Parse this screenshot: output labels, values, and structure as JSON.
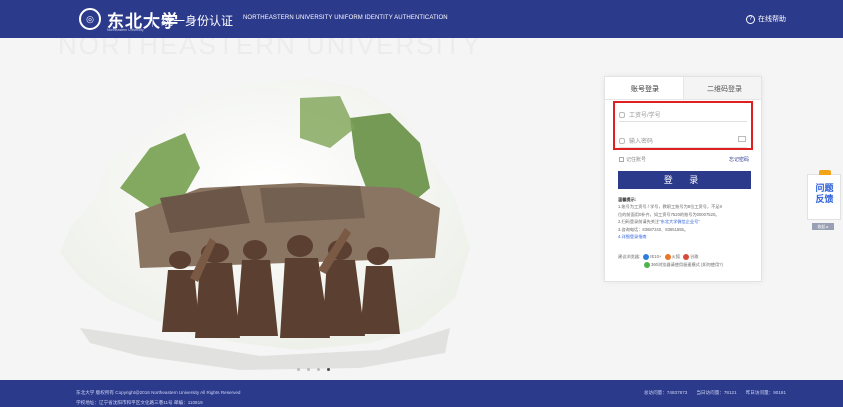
{
  "header": {
    "logo_cn": "东北大学",
    "logo_en": "Northeastern University",
    "title_cn": "统一身份认证",
    "title_en": "NORTHEASTERN UNIVERSITY UNIFORM IDENTITY AUTHENTICATION",
    "help_label": "在线帮助"
  },
  "background": {
    "watermark": "NORTHEASTERN UNIVERSITY"
  },
  "login": {
    "tab_account": "账号登录",
    "tab_qrcode": "二维码登录",
    "username_placeholder": "工资号/学号",
    "password_placeholder": "输入密码",
    "remember_label": "记住账号",
    "forgot_label": "忘记密码",
    "submit_label": "登 录"
  },
  "tips": {
    "title": "温馨提示:",
    "line1": "1.账号为工资号 / 学号，教职工账号为8位工资号，不足8",
    "line2": "位的前面用0补齐，如工资号7520的账号为00007520。",
    "line3_prefix": "2.扫码登录前请先关注",
    "line3_link": "“东北大学微信企业号”",
    "line4": "3.咨询电话：83687240、83651555。",
    "line5": "4.详细登录指南"
  },
  "browsers": {
    "label": "建议浏览器:",
    "ie": "IE10+",
    "firefox": "火狐",
    "chrome": "谷歌",
    "note360": "360浏览器请使用极速模式 (如何使用?)"
  },
  "carousel": {
    "total": 4,
    "active": 4
  },
  "feedback": {
    "line1": "问题",
    "line2": "反馈",
    "collapse_label": "收起 ▸"
  },
  "footer": {
    "copyright": "东北大学 版权所有 Copyright@2016 Northeastern University All Rights Reserved",
    "address": "学校地址：辽宁省沈阳市和平区文化路三巷11号 邮编：110819",
    "stat1": "总访问量：74837873",
    "stat2": "当日访问量：78121",
    "stat3": "昨日访问量：90181"
  },
  "colors": {
    "brand": "#2c3a8c",
    "highlight": "#e02020",
    "feedback_accent": "#f2a51a"
  }
}
